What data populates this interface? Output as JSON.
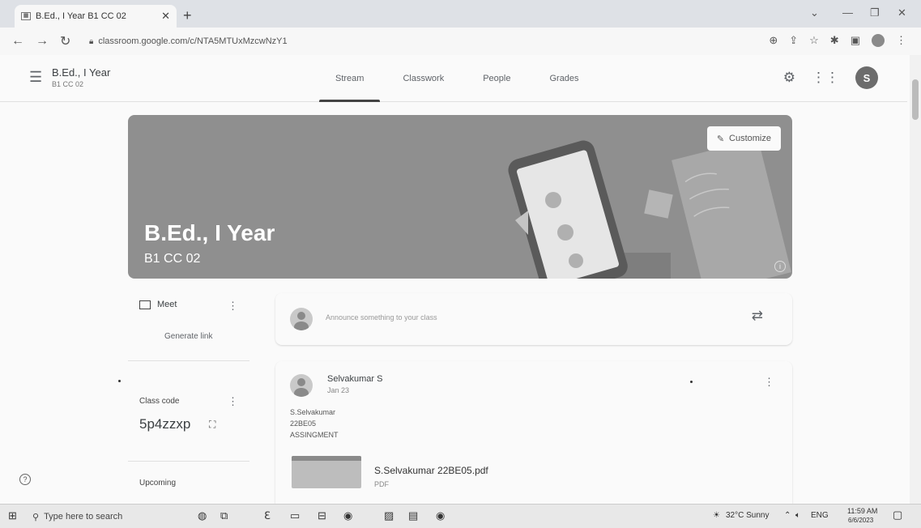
{
  "browser": {
    "tab_title": "B.Ed., I Year B1 CC 02",
    "url": "classroom.google.com/c/NTA5MTUxMzcwNzY1"
  },
  "appbar": {
    "class_name": "B.Ed., I Year",
    "class_section": "B1 CC 02",
    "tabs": [
      "Stream",
      "Classwork",
      "People",
      "Grades"
    ],
    "active_tab": "Stream",
    "user_initial": "S"
  },
  "banner": {
    "title": "B.Ed., I Year",
    "subtitle": "B1 CC 02",
    "customize_label": "Customize"
  },
  "meet": {
    "label": "Meet",
    "generate_link": "Generate link"
  },
  "class_code": {
    "label": "Class code",
    "code": "5p4zzxp"
  },
  "upcoming": {
    "label": "Upcoming"
  },
  "announce": {
    "placeholder": "Announce something to your class"
  },
  "post": {
    "author": "Selvakumar S",
    "date": "Jan 23",
    "body_lines": [
      "S.Selvakumar",
      "22BE05",
      "ASSINGMENT"
    ],
    "attachment_name": "S.Selvakumar 22BE05.pdf",
    "attachment_type": "PDF"
  },
  "taskbar": {
    "search_placeholder": "Type here to search",
    "weather": "32°C Sunny",
    "language": "ENG",
    "time": "11:59 AM",
    "date": "6/6/2023"
  },
  "colors": {
    "banner": "#8f8f8f",
    "background": "#fafafa",
    "accent": "#444444"
  }
}
